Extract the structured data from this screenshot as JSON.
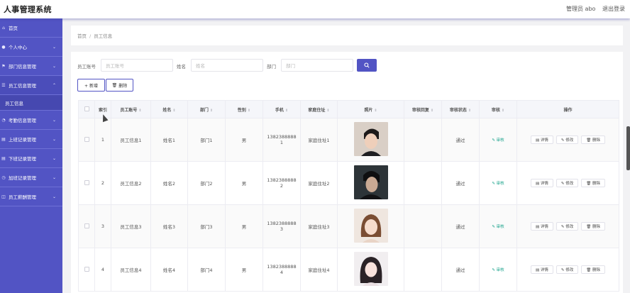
{
  "app_title": "人事管理系统",
  "header": {
    "admin_label": "管理员 abo",
    "logout_label": "退出登录"
  },
  "sidebar": {
    "items": [
      {
        "label": "首页",
        "icon": "home-icon",
        "has_children": false
      },
      {
        "label": "个人中心",
        "icon": "user-icon",
        "has_children": true
      },
      {
        "label": "部门信息管理",
        "icon": "flag-icon",
        "has_children": true
      },
      {
        "label": "员工信息管理",
        "icon": "users-icon",
        "has_children": true,
        "expanded": true
      },
      {
        "label": "考勤信息管理",
        "icon": "clock-icon",
        "has_children": true
      },
      {
        "label": "上班记录管理",
        "icon": "clipboard-icon",
        "has_children": true
      },
      {
        "label": "下班记录管理",
        "icon": "clipboard-icon",
        "has_children": true
      },
      {
        "label": "加班记录管理",
        "icon": "timer-icon",
        "has_children": true
      },
      {
        "label": "员工薪酬管理",
        "icon": "wallet-icon",
        "has_children": true
      }
    ],
    "subitem": "员工信息"
  },
  "breadcrumb": {
    "home": "首页",
    "separator": "/",
    "current": "员工信息"
  },
  "search": {
    "fields": [
      {
        "label": "员工账号",
        "placeholder": "员工账号"
      },
      {
        "label": "姓名",
        "placeholder": "姓名"
      },
      {
        "label": "部门",
        "placeholder": "部门"
      }
    ]
  },
  "actions": {
    "add_label": "+ 新增",
    "delete_label": "删除"
  },
  "table": {
    "headers": [
      "索引",
      "员工账号",
      "姓名",
      "部门",
      "性别",
      "手机",
      "家庭住址",
      "照片",
      "审核回复",
      "审核状态",
      "审核",
      "操作"
    ],
    "rows": [
      {
        "index": "1",
        "account": "员工信息1",
        "name": "姓名1",
        "dept": "部门1",
        "gender": "男",
        "phone_a": "1382388888",
        "phone_b": "1",
        "address": "家庭住址1",
        "reply": "",
        "status": "通过"
      },
      {
        "index": "2",
        "account": "员工信息2",
        "name": "姓名2",
        "dept": "部门2",
        "gender": "男",
        "phone_a": "1382388888",
        "phone_b": "2",
        "address": "家庭住址2",
        "reply": "",
        "status": "通过"
      },
      {
        "index": "3",
        "account": "员工信息3",
        "name": "姓名3",
        "dept": "部门3",
        "gender": "男",
        "phone_a": "1382388888",
        "phone_b": "3",
        "address": "家庭住址3",
        "reply": "",
        "status": "通过"
      },
      {
        "index": "4",
        "account": "员工信息4",
        "name": "姓名4",
        "dept": "部门4",
        "gender": "男",
        "phone_a": "1382388888",
        "phone_b": "4",
        "address": "家庭住址4",
        "reply": "",
        "status": "通过"
      }
    ],
    "audit_label": "审核",
    "row_actions": {
      "detail": "详情",
      "edit": "修改",
      "delete": "删除"
    }
  },
  "colors": {
    "primary": "#5254c4",
    "audit_link": "#1ba38c"
  }
}
